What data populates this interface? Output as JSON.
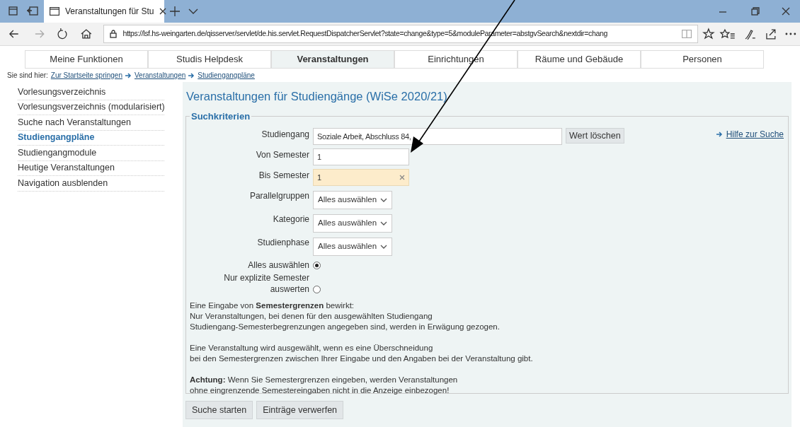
{
  "browser": {
    "tab_title": "Veranstaltungen für Stu",
    "url": "https://lsf.hs-weingarten.de/qisserver/servlet/de.his.servlet.RequestDispatcherServlet?state=change&type=5&moduleParameter=abstgvSearch&nextdir=chang"
  },
  "nav_tabs": [
    {
      "label": "Meine Funktionen",
      "selected": false
    },
    {
      "label": "Studis Helpdesk",
      "selected": false
    },
    {
      "label": "Veranstaltungen",
      "selected": true
    },
    {
      "label": "Einrichtungen",
      "selected": false
    },
    {
      "label": "Räume und Gebäude",
      "selected": false
    },
    {
      "label": "Personen",
      "selected": false
    }
  ],
  "breadcrumb": {
    "prefix": "Sie sind hier:",
    "links": [
      "Zur Startseite springen",
      "Veranstaltungen",
      "Studiengangpläne"
    ]
  },
  "sidebar": {
    "items": [
      {
        "label": "Vorlesungsverzeichnis",
        "selected": false
      },
      {
        "label": "Vorlesungsverzeichnis (modularisiert)",
        "selected": false
      },
      {
        "label": "Suche nach Veranstaltungen",
        "selected": false
      },
      {
        "label": "Studiengangpläne",
        "selected": true
      },
      {
        "label": "Studiengangmodule",
        "selected": false
      },
      {
        "label": "Heutige Veranstaltungen",
        "selected": false
      },
      {
        "label": "Navigation ausblenden",
        "selected": false
      }
    ]
  },
  "main": {
    "title": "Veranstaltungen für Studiengänge (WiSe 2020/21)",
    "legend": "Suchkriterien",
    "help_link": "Hilfe zur Suche",
    "fields": [
      {
        "kind": "text",
        "label": "Studiengang",
        "value": "Soziale Arbeit, Abschluss 84,",
        "wide": true,
        "button": "Wert löschen",
        "focused": false
      },
      {
        "kind": "text",
        "label": "Von Semester",
        "value": "1",
        "wide": false,
        "focused": false
      },
      {
        "kind": "text",
        "label": "Bis Semester",
        "value": "1",
        "wide": false,
        "focused": true
      },
      {
        "kind": "select",
        "label": "Parallelgruppen",
        "value": "Alles auswählen"
      },
      {
        "kind": "select",
        "label": "Kategorie",
        "value": "Alles auswählen"
      },
      {
        "kind": "select",
        "label": "Studienphase",
        "value": "Alles auswählen"
      },
      {
        "kind": "radio",
        "label": "Alles auswählen",
        "selected": true
      },
      {
        "kind": "radio",
        "label": "Nur explizite Semester auswerten",
        "selected": false
      }
    ],
    "info": [
      [
        "Eine Eingabe von **Semestergrenzen** bewirkt:",
        "Nur Veranstaltungen, bei denen für den ausgewählten Studiengang",
        "Studiengang-Semesterbegrenzungen angegeben sind, werden in Erwägung gezogen."
      ],
      [
        "Eine Veranstaltung wird ausgewählt, wenn es eine Überschneidung",
        "bei den Semestergrenzen zwischen Ihrer Eingabe und den Angaben bei der Veranstaltung gibt."
      ],
      [
        "**Achtung:** Wenn Sie Semestergrenzen eingeben, werden Veranstaltungen",
        "ohne eingrenzende Semestereingaben nicht in die Anzeige einbezogen!"
      ]
    ],
    "buttons": [
      "Suche starten",
      "Einträge verwerfen"
    ]
  }
}
